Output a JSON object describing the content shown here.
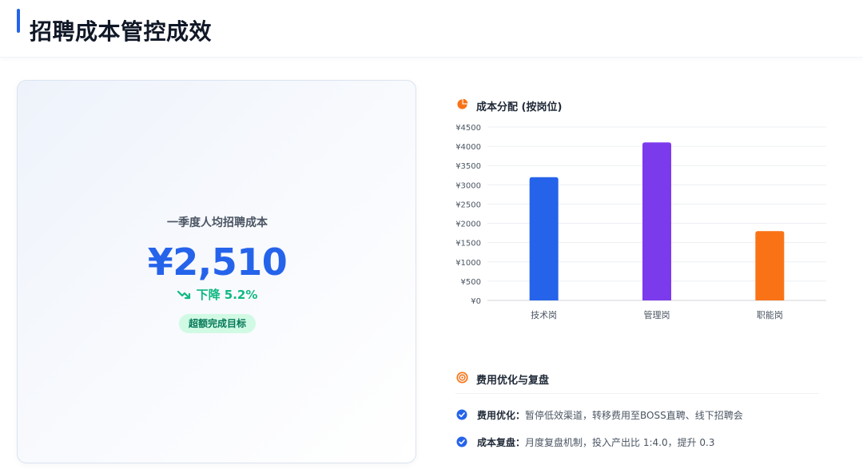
{
  "header": {
    "title": "招聘成本管控成效"
  },
  "kpi": {
    "label": "一季度人均招聘成本",
    "value": "¥2,510",
    "trend": "下降 5.2%",
    "badge": "超额完成目标"
  },
  "cost_section": {
    "title": "成本分配 (按岗位)"
  },
  "chart_data": {
    "type": "bar",
    "categories": [
      "技术岗",
      "管理岗",
      "职能岗"
    ],
    "values": [
      3200,
      4100,
      1800
    ],
    "colors": [
      "#2563eb",
      "#7c3aed",
      "#f97316"
    ],
    "ylim": [
      0,
      4500
    ],
    "yticks": [
      "¥0",
      "¥500",
      "¥1000",
      "¥1500",
      "¥2000",
      "¥2500",
      "¥3000",
      "¥3500",
      "¥4000",
      "¥4500"
    ],
    "grid": true
  },
  "review": {
    "title": "费用优化与复盘",
    "items": [
      {
        "key": "费用优化：",
        "text": "暂停低效渠道，转移费用至BOSS直聘、线下招聘会"
      },
      {
        "key": "成本复盘：",
        "text": "月度复盘机制，投入产出比 1:4.0，提升 0.3"
      }
    ]
  },
  "colors": {
    "primary": "#2563eb",
    "success": "#10b981",
    "accent": "#f97316",
    "purple": "#7c3aed"
  }
}
